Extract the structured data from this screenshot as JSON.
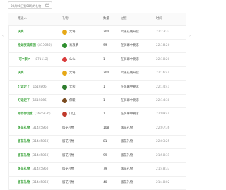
{
  "filter": {
    "date_placeholder": "08月08日到08月的礼物"
  },
  "table": {
    "columns": [
      "赠送人",
      "礼物",
      "数量",
      "过程",
      "时间"
    ],
    "rows": [
      {
        "name": "庆典",
        "id": "",
        "gift": "大将",
        "gift_color": "#e6a817",
        "qty": "200",
        "src": "六道在线开启",
        "time": "22:23:32"
      },
      {
        "name": "相如安装商团",
        "id": "（815636）",
        "gift": "青浪草",
        "gift_color": "#2f8f2f",
        "qty": "99",
        "src": "在屏幕中要求",
        "time": "22:18:26"
      },
      {
        "name": "·可❤家❤~",
        "id": "（871112）",
        "gift": "么么",
        "gift_color": "#d93b3b",
        "qty": "1",
        "src": "在屏幕中要求",
        "time": "22:18:20"
      },
      {
        "name": "庆典",
        "id": "",
        "gift": "大将",
        "gift_color": "#e6a817",
        "qty": "200",
        "src": "六道在线开启",
        "time": "22:16:44"
      },
      {
        "name": "灯话定了",
        "id": "（1619866）",
        "gift": "大客",
        "gift_color": "#2e7d2e",
        "qty": "1",
        "src": "在屏幕中要求",
        "time": "22:14:41"
      },
      {
        "name": "灯话定了",
        "id": "（1619866）",
        "gift": "保暖",
        "gift_color": "#7a4b1f",
        "qty": "1",
        "src": "在屏幕中要求",
        "time": "22:14:38"
      },
      {
        "name": "即作你流盘",
        "id": "（1676876）",
        "gift": "口红",
        "gift_color": "#c0392b",
        "qty": "1",
        "src": "在屏幕中要求",
        "time": "22:09:44"
      },
      {
        "name": "版花礼物",
        "id": "（31445860）",
        "gift": "版花礼物",
        "gift_color": "",
        "qty": "108",
        "src": "版花礼物",
        "time": "22:07:36"
      },
      {
        "name": "版花礼物",
        "id": "（31445860）",
        "gift": "版花礼物",
        "gift_color": "",
        "qty": "81",
        "src": "版花礼物",
        "time": "22:03:25"
      },
      {
        "name": "版花礼物",
        "id": "（31445860）",
        "gift": "版花礼物",
        "gift_color": "",
        "qty": "99",
        "src": "版花礼物",
        "time": "21:58:31"
      },
      {
        "name": "版花礼物",
        "id": "（31445860）",
        "gift": "版花礼物",
        "gift_color": "",
        "qty": "79",
        "src": "版花礼物",
        "time": "21:48:33"
      },
      {
        "name": "版花礼物",
        "id": "（31445860）",
        "gift": "版花礼物",
        "gift_color": "",
        "qty": "40",
        "src": "版花礼物",
        "time": "21:48:02"
      }
    ]
  },
  "icons": {
    "date": "calendar-icon",
    "scroll_left": "chevron-left-icon",
    "scroll_right": "chevron-right-icon"
  }
}
